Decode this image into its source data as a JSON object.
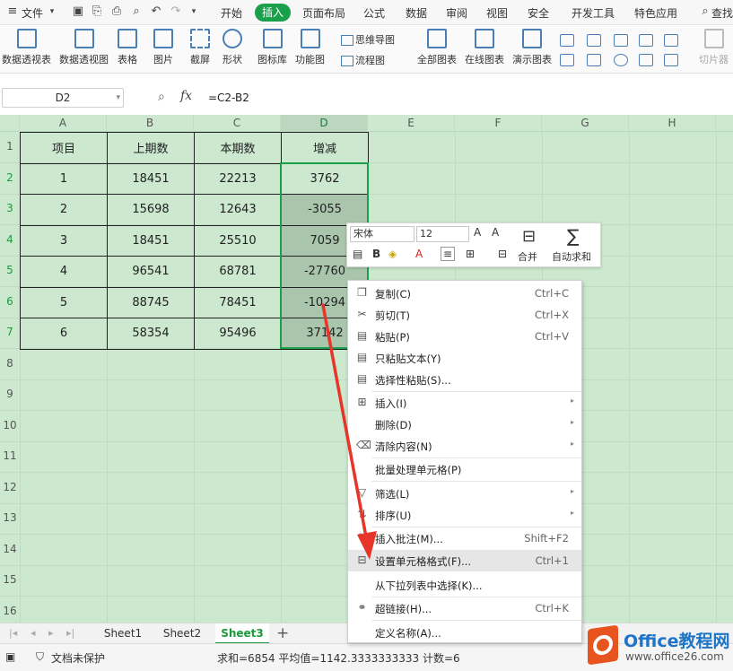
{
  "topbar": {
    "file_label": "文件",
    "tabs": [
      "开始",
      "插入",
      "页面布局",
      "公式",
      "数据",
      "审阅",
      "视图",
      "安全",
      "开发工具",
      "特色应用"
    ],
    "active_tab": "插入",
    "search_label": "查找"
  },
  "ribbon": {
    "pivot_table": "数据透视表",
    "pivot_chart": "数据透视图",
    "table": "表格",
    "picture": "图片",
    "screenshot": "截屏",
    "shapes": "形状",
    "icon_library": "图标库",
    "function_chart": "功能图",
    "mindmap": "思维导图",
    "flowchart": "流程图",
    "all_charts": "全部图表",
    "online_charts": "在线图表",
    "presentation_charts": "演示图表",
    "slicer": "切片器"
  },
  "formula_bar": {
    "name_box": "D2",
    "fx": "fx",
    "formula": "=C2-B2"
  },
  "columns": [
    "A",
    "B",
    "C",
    "D",
    "E",
    "F",
    "G",
    "H"
  ],
  "selected_column": "D",
  "rows": [
    "1",
    "2",
    "3",
    "4",
    "5",
    "6",
    "7",
    "8",
    "9",
    "10",
    "11",
    "12",
    "13",
    "14",
    "15",
    "16"
  ],
  "table": {
    "headers": [
      "项目",
      "上期数",
      "本期数",
      "增减"
    ],
    "rows": [
      [
        "1",
        "18451",
        "22213",
        "3762"
      ],
      [
        "2",
        "15698",
        "12643",
        "-3055"
      ],
      [
        "3",
        "18451",
        "25510",
        "7059"
      ],
      [
        "4",
        "96541",
        "68781",
        "-27760"
      ],
      [
        "5",
        "88745",
        "78451",
        "-10294"
      ],
      [
        "6",
        "58354",
        "95496",
        "37142"
      ]
    ]
  },
  "sheet_tabs": [
    "Sheet1",
    "Sheet2",
    "Sheet3"
  ],
  "active_sheet": "Sheet3",
  "status": {
    "protect": "文档未保护",
    "summary": "求和=6854  平均值=1142.3333333333  计数=6"
  },
  "mini_toolbar": {
    "font": "宋体",
    "size": "12",
    "merge": "合并",
    "autosum": "自动求和"
  },
  "context_menu": [
    {
      "label": "复制(C)",
      "shortcut": "Ctrl+C",
      "icon": "copy-icon"
    },
    {
      "label": "剪切(T)",
      "shortcut": "Ctrl+X",
      "icon": "cut-icon"
    },
    {
      "label": "粘贴(P)",
      "shortcut": "Ctrl+V",
      "icon": "paste-icon"
    },
    {
      "label": "只粘贴文本(Y)",
      "shortcut": "",
      "icon": "paste-text-icon"
    },
    {
      "label": "选择性粘贴(S)...",
      "shortcut": "",
      "icon": "paste-special-icon"
    },
    {
      "label": "插入(I)",
      "shortcut": "",
      "icon": "insert-icon",
      "submenu": true
    },
    {
      "label": "删除(D)",
      "shortcut": "",
      "icon": "",
      "submenu": true
    },
    {
      "label": "清除内容(N)",
      "shortcut": "",
      "icon": "eraser-icon",
      "submenu": true
    },
    {
      "label": "批量处理单元格(P)",
      "shortcut": "",
      "icon": ""
    },
    {
      "label": "筛选(L)",
      "shortcut": "",
      "icon": "filter-icon",
      "submenu": true
    },
    {
      "label": "排序(U)",
      "shortcut": "",
      "icon": "sort-icon",
      "submenu": true
    },
    {
      "label": "插入批注(M)...",
      "shortcut": "Shift+F2",
      "icon": "comment-icon"
    },
    {
      "label": "设置单元格格式(F)...",
      "shortcut": "Ctrl+1",
      "icon": "format-cells-icon",
      "highlighted": true
    },
    {
      "label": "从下拉列表中选择(K)...",
      "shortcut": "",
      "icon": ""
    },
    {
      "label": "超链接(H)...",
      "shortcut": "Ctrl+K",
      "icon": "link-icon"
    },
    {
      "label": "定义名称(A)...",
      "shortcut": "",
      "icon": ""
    }
  ],
  "watermark": {
    "title": "Office教程网",
    "url": "www.office26.com"
  },
  "colors": {
    "accent": "#1aa04a",
    "sheet_bg": "#cce8cf",
    "arrow": "#e8352a"
  }
}
